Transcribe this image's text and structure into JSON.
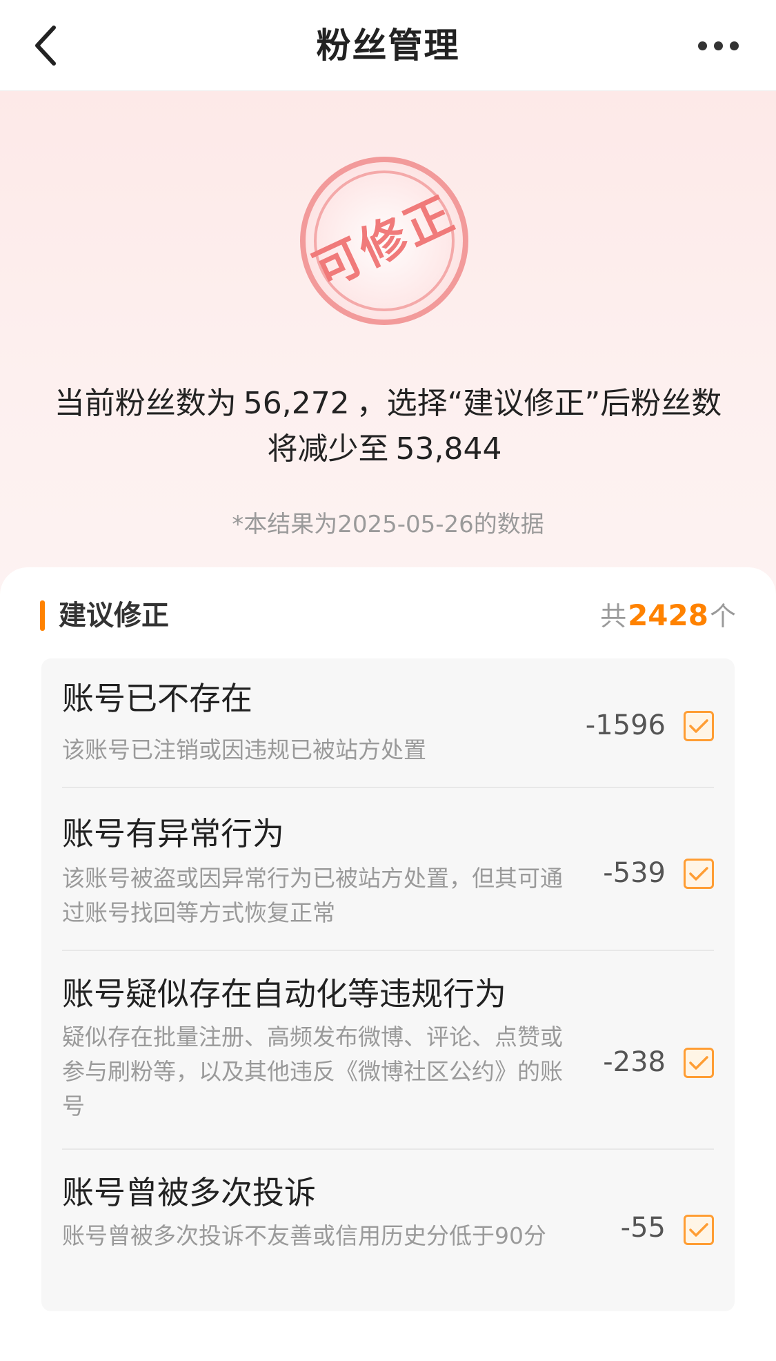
{
  "header": {
    "title": "粉丝管理"
  },
  "hero": {
    "stamp_text": "可修正",
    "summary_part1": "当前粉丝数为",
    "current_fans": "56,272",
    "summary_part2": "，选择“建议修正”后粉丝数将减少至",
    "corrected_fans": "53,844",
    "note": "*本结果为2025-05-26的数据"
  },
  "section": {
    "title": "建议修正",
    "count_prefix": "共",
    "count": "2428",
    "count_suffix": "个"
  },
  "items": [
    {
      "title": "账号已不存在",
      "desc": "该账号已注销或因违规已被站方处置",
      "value": "-1596",
      "checked": true
    },
    {
      "title": "账号有异常行为",
      "desc": "该账号被盗或因异常行为已被站方处置，但其可通过账号找回等方式恢复正常",
      "value": "-539",
      "checked": true
    },
    {
      "title": "账号疑似存在自动化等违规行为",
      "desc": "疑似存在批量注册、高频发布微博、评论、点赞或参与刷粉等，以及其他违反《微博社区公约》的账号",
      "value": "-238",
      "checked": true
    },
    {
      "title": "账号曾被多次投诉",
      "desc": "账号曾被多次投诉不友善或信用历史分低于90分",
      "value": "-55",
      "checked": true
    }
  ],
  "colors": {
    "accent": "#ff8200",
    "checkbox": "#ff9d33",
    "stamp": "#f07a7a"
  }
}
